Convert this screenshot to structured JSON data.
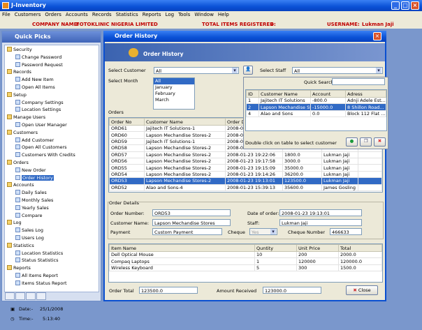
{
  "window": {
    "title": "J-Inventory"
  },
  "menu": [
    "File",
    "Customers",
    "Orders",
    "Accounts",
    "Records",
    "Statistics",
    "Reports",
    "Log",
    "Tools",
    "Window",
    "Help"
  ],
  "info": {
    "company_label": "COMPANY NAME:",
    "company": "FOTOKLINIC NIGERIA LIMITED",
    "items_label": "TOTAL ITEMS REGISTERED:",
    "items": "4",
    "user_label": "USERNAME:",
    "user": "Lukman Jaji"
  },
  "sidebar": {
    "title": "Quick Picks",
    "tree": [
      {
        "label": "Security",
        "level": 0
      },
      {
        "label": "Change Password",
        "level": 1
      },
      {
        "label": "Password Request",
        "level": 1
      },
      {
        "label": "Records",
        "level": 0
      },
      {
        "label": "Add New Item",
        "level": 1
      },
      {
        "label": "Open All Items",
        "level": 1
      },
      {
        "label": "Setup",
        "level": 0
      },
      {
        "label": "Company Settings",
        "level": 1
      },
      {
        "label": "Location Settings",
        "level": 1
      },
      {
        "label": "Manage Users",
        "level": 0
      },
      {
        "label": "Open User Manager",
        "level": 1
      },
      {
        "label": "Customers",
        "level": 0
      },
      {
        "label": "Add Customer",
        "level": 1
      },
      {
        "label": "Open All Customers",
        "level": 1
      },
      {
        "label": "Customers With Credits",
        "level": 1
      },
      {
        "label": "Orders",
        "level": 0
      },
      {
        "label": "New Order",
        "level": 1
      },
      {
        "label": "Order History",
        "level": 1,
        "selected": true
      },
      {
        "label": "Accounts",
        "level": 0
      },
      {
        "label": "Daily Sales",
        "level": 1
      },
      {
        "label": "Monthly Sales",
        "level": 1
      },
      {
        "label": "Yearly Sales",
        "level": 1
      },
      {
        "label": "Compare",
        "level": 1
      },
      {
        "label": "Log",
        "level": 0
      },
      {
        "label": "Sales Log",
        "level": 1
      },
      {
        "label": "Users Log",
        "level": 1
      },
      {
        "label": "Statistics",
        "level": 0
      },
      {
        "label": "Location Statistics",
        "level": 1
      },
      {
        "label": "Status Statistics",
        "level": 1
      },
      {
        "label": "Reports",
        "level": 0
      },
      {
        "label": "All Items Report",
        "level": 1
      },
      {
        "label": "Items Status Report",
        "level": 1
      }
    ],
    "date_label": "Date:-",
    "date": "25/1/2008",
    "time_label": "Time:-",
    "time": "5:13:40"
  },
  "dialog": {
    "title": "Order History",
    "banner": "Order History",
    "select_customer_label": "Select Customer",
    "select_customer_value": "All",
    "select_month_label": "Select Month",
    "months": [
      "All",
      "January",
      "February",
      "March"
    ],
    "select_staff_label": "Select Staff",
    "select_staff_value": "All",
    "orders_label": "Orders",
    "orders_headers": [
      "Order No",
      "Customer Name",
      "Order D",
      "",
      "",
      ""
    ],
    "orders": [
      [
        "ORD61",
        "Jajitech IT Solutions-1",
        "2008-0",
        "",
        "",
        ""
      ],
      [
        "ORD60",
        "Lapson Mechandise Stores-2",
        "2008-0",
        "",
        "",
        ""
      ],
      [
        "ORD59",
        "Jajitech IT Solutions-1",
        "2008-0",
        "",
        "",
        ""
      ],
      [
        "ORD58",
        "Lapson Mechandise Stores-2",
        "2008-0",
        "",
        "",
        ""
      ],
      [
        "ORD57",
        "Lapson Mechandise Stores-2",
        "2008-01-23 19:22:06",
        "1800.0",
        "Lukman Jaji",
        ""
      ],
      [
        "ORD56",
        "Lapson Mechandise Stores-2",
        "2008-01-23 19:17:58",
        "3000.0",
        "Lukman Jaji",
        ""
      ],
      [
        "ORD55",
        "Lapson Mechandise Stores-2",
        "2008-01-23 19:15:09",
        "35000.0",
        "Lukman Jaji",
        ""
      ],
      [
        "ORD54",
        "Lapson Mechandise Stores-2",
        "2008-01-23 19:14:26",
        "36200.0",
        "Lukman Jaji",
        ""
      ],
      [
        "ORD53",
        "Lapson Mechandise Stores-2",
        "2008-01-23 19:13:01",
        "123500.0",
        "Lukman Jaji",
        ""
      ],
      [
        "ORD52",
        "Alao and Sons-4",
        "2008-01-23 15:39:13",
        "35600.0",
        "James Gosling",
        ""
      ]
    ],
    "selected_order_index": 8,
    "details_label": "Order Details",
    "order_number_label": "Order Number:",
    "order_number": "ORD53",
    "date_of_order_label": "Date of order:",
    "date_of_order": "2008-01-23 19:13:01",
    "customer_name_label": "Customer Name:",
    "customer_name": "Lapson Mechandise Stores",
    "staff_label": "Staff:",
    "staff": "Lukman Jaji",
    "payment_label": "Payment",
    "payment": "Custom Payment",
    "cheque_label": "Cheque",
    "cheque": "Yes",
    "cheque_number_label": "Cheque Number",
    "cheque_number": "466633",
    "items_headers": [
      "Item Name",
      "Quntity",
      "Unit Price",
      "Total"
    ],
    "items": [
      [
        "Dell Optical Mouse",
        "10",
        "200",
        "2000.0"
      ],
      [
        "Compaq Laptops",
        "1",
        "120000",
        "120000.0"
      ],
      [
        "Wireless Keyboard",
        "5",
        "300",
        "1500.0"
      ]
    ],
    "order_total_label": "Order Total",
    "order_total": "123500.0",
    "amount_received_label": "Amount Received",
    "amount_received": "123000.0",
    "close_label": "Close"
  },
  "popup": {
    "quick_search_label": "Quick Search",
    "headers": [
      "ID",
      "Customer Name",
      "Account",
      "Adress"
    ],
    "rows": [
      [
        "1",
        "Jajitech IT Solutions",
        "-800.0",
        "Adnji Adele Est..."
      ],
      [
        "2",
        "Lapson Mechandise Stores",
        "-15000.0",
        "8 Shillon Road..."
      ],
      [
        "4",
        "Alao and Sons",
        "0.0",
        "Block 112 Flat ..."
      ]
    ],
    "selected_index": 1,
    "hint": "Double click on table to select customer"
  }
}
